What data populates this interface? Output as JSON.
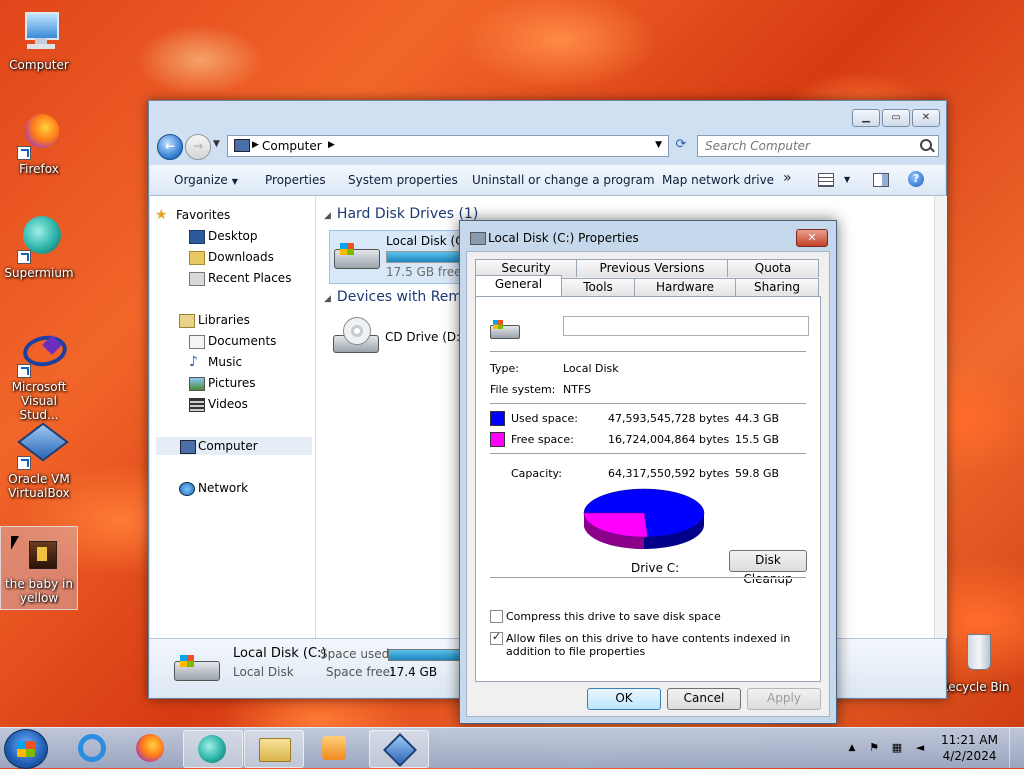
{
  "desktop": {
    "icons": [
      {
        "label": "Computer"
      },
      {
        "label": "Firefox"
      },
      {
        "label": "Supermium"
      },
      {
        "label": "Microsoft Visual Stud..."
      },
      {
        "label": "Oracle VM VirtualBox"
      },
      {
        "label": "the baby in yellow"
      },
      {
        "label": "Recycle Bin"
      }
    ]
  },
  "explorer": {
    "breadcrumb": "Computer",
    "search_placeholder": "Search Computer",
    "toolbar": {
      "organize": "Organize",
      "properties": "Properties",
      "system_properties": "System properties",
      "uninstall": "Uninstall or change a program",
      "map_drive": "Map network drive",
      "more": "»"
    },
    "nav": {
      "favorites": "Favorites",
      "desktop": "Desktop",
      "downloads": "Downloads",
      "recent": "Recent Places",
      "libraries": "Libraries",
      "documents": "Documents",
      "music": "Music",
      "pictures": "Pictures",
      "videos": "Videos",
      "computer": "Computer",
      "network": "Network"
    },
    "groups": {
      "hard_disks": "Hard Disk Drives (1)",
      "devices": "Devices with Remo"
    },
    "drives": {
      "c_name": "Local Disk (C:)",
      "c_free": "17.5 GB free o",
      "c_used_fraction": 0.74,
      "d_name": "CD Drive (D:)"
    },
    "details": {
      "name": "Local Disk (C:)",
      "type": "Local Disk",
      "used_label": "Space used:",
      "free_label": "Space free:",
      "free_value": "17.4 GB"
    }
  },
  "dialog": {
    "title": "Local Disk (C:) Properties",
    "close": "✕",
    "tabs_top": [
      "Security",
      "Previous Versions",
      "Quota"
    ],
    "tabs_bottom": [
      "General",
      "Tools",
      "Hardware",
      "Sharing"
    ],
    "active_tab": "General",
    "volume_label_value": "",
    "type_label": "Type:",
    "type_value": "Local Disk",
    "fs_label": "File system:",
    "fs_value": "NTFS",
    "used_label": "Used space:",
    "used_bytes": "47,593,545,728 bytes",
    "used_gb": "44.3 GB",
    "free_label": "Free space:",
    "free_bytes": "16,724,004,864 bytes",
    "free_gb": "15.5 GB",
    "capacity_label": "Capacity:",
    "capacity_bytes": "64,317,550,592 bytes",
    "capacity_gb": "59.8 GB",
    "drive_caption": "Drive C:",
    "disk_cleanup": "Disk Cleanup",
    "compress_label": "Compress this drive to save disk space",
    "compress_checked": false,
    "index_label": "Allow files on this drive to have contents indexed in addition to file properties",
    "index_checked": true,
    "ok": "OK",
    "cancel": "Cancel",
    "apply": "Apply",
    "colors": {
      "used": "#0000ff",
      "free": "#ff00ff"
    }
  },
  "taskbar": {
    "time": "11:21 AM",
    "date": "4/2/2024"
  }
}
